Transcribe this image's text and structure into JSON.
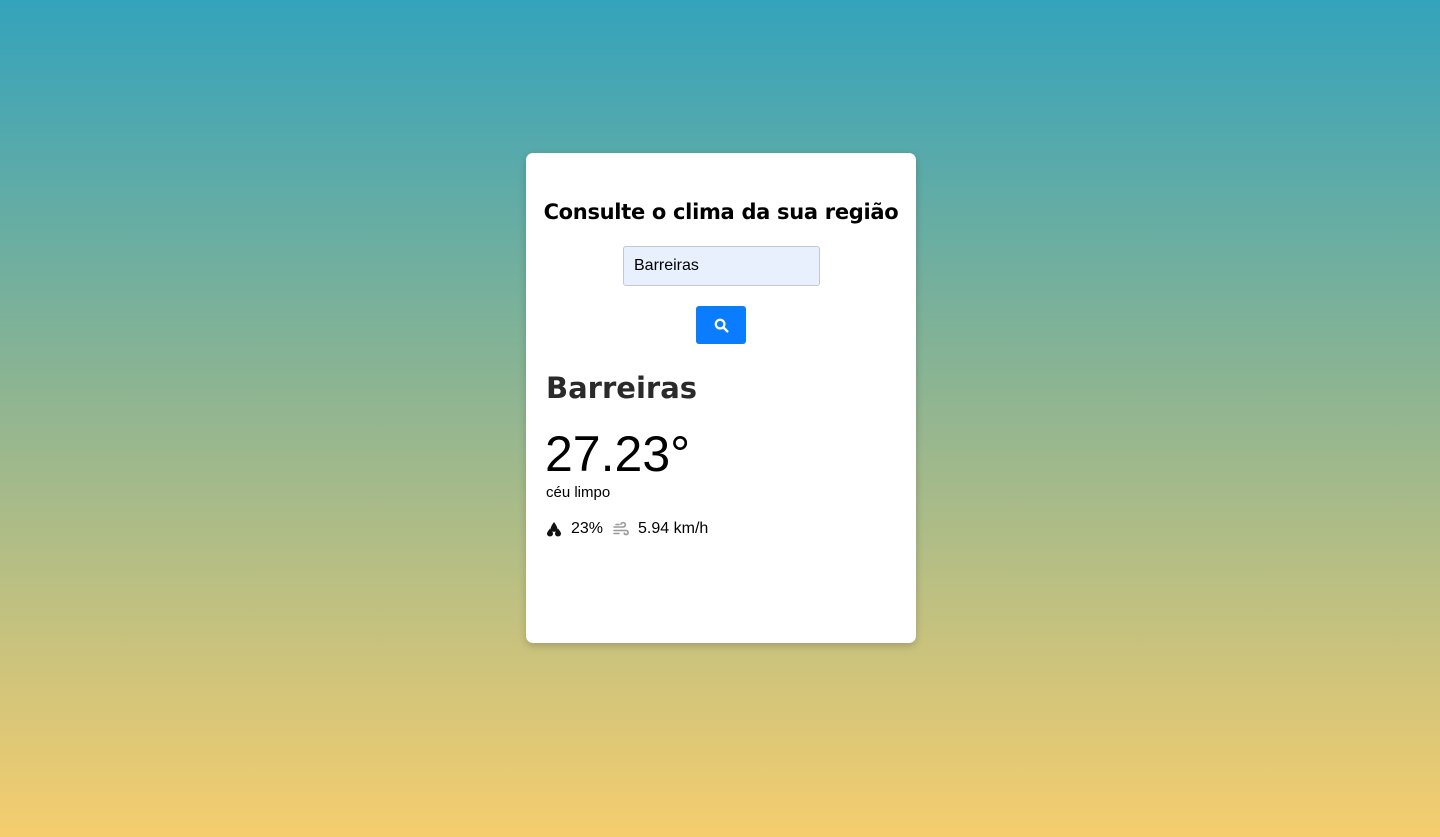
{
  "page": {
    "background_top": "#34a3bb",
    "background_bottom": "#f6cd6e"
  },
  "card": {
    "title": "Consulte o clima da sua região",
    "search": {
      "value": "Barreiras",
      "placeholder": ""
    },
    "search_button": {
      "icon": "search-icon",
      "color": "#0a7cff"
    },
    "weather": {
      "city": "Barreiras",
      "temperature": "27.23°",
      "description": "céu limpo",
      "humidity_icon": "droplets-icon",
      "humidity": "23%",
      "wind_icon": "wind-icon",
      "wind_speed": "5.94 km/h"
    }
  }
}
